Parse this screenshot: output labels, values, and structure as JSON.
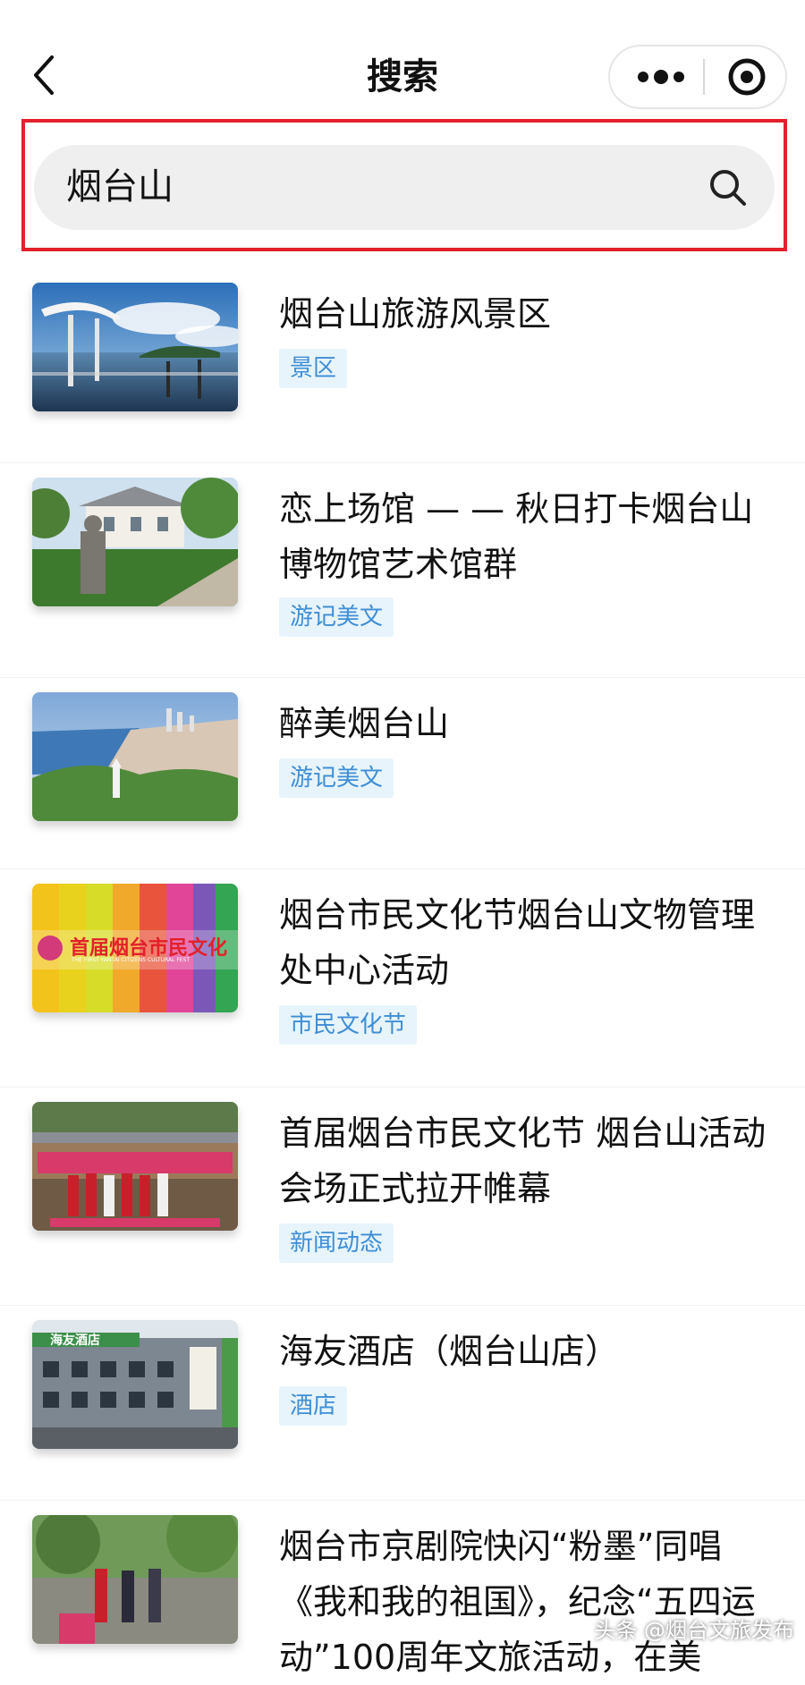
{
  "navbar": {
    "title": "搜索",
    "back_icon": "chevron-left-icon",
    "more_icon": "more-dots-icon",
    "close_icon": "target-circle-icon"
  },
  "search": {
    "query": "烟台山",
    "icon": "search-icon",
    "highlight_color": "#e3202b"
  },
  "results": [
    {
      "title": "烟台山旅游风景区",
      "tag": "景区"
    },
    {
      "title": "恋上场馆 — — 秋日打卡烟台山博物馆艺术馆群",
      "tag": "游记美文"
    },
    {
      "title": "醉美烟台山",
      "tag": "游记美文"
    },
    {
      "title": "烟台市民文化节烟台山文物管理处中心活动",
      "tag": "市民文化节",
      "thumb_text": "首届烟台市民文化",
      "thumb_subtext": "THE FIRST YANTAI CITIZENS CULTURAL FEST"
    },
    {
      "title": "首届烟台市民文化节 烟台山活动会场正式拉开帷幕",
      "tag": "新闻动态"
    },
    {
      "title": "海友酒店（烟台山店）",
      "tag": "酒店",
      "thumb_text": "海友酒店"
    },
    {
      "title": "烟台市京剧院快闪“粉墨”同唱《我和我的祖国》，纪念“五四运动”100周年文旅活动，在美"
    }
  ],
  "colors": {
    "tag_bg": "#e7f4fb",
    "tag_text": "#3f8ed6"
  },
  "watermark": "头条 @烟台文旅发布"
}
